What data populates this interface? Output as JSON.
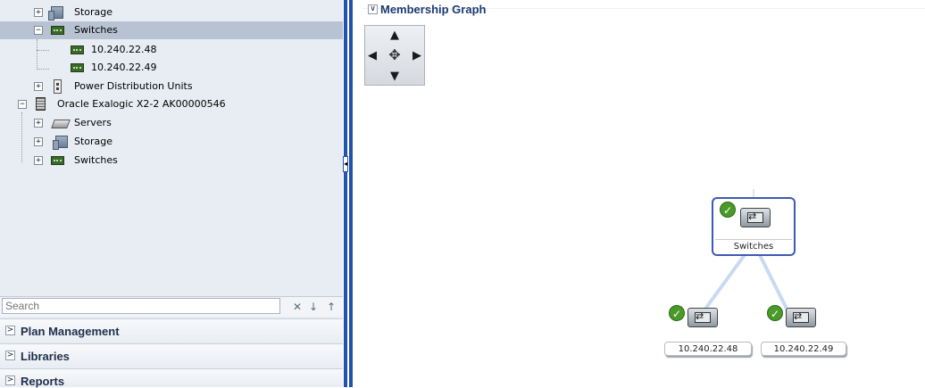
{
  "tree": {
    "items": [
      {
        "label": "Storage",
        "icon": "storage-icon",
        "expander": "+"
      },
      {
        "label": "Switches",
        "icon": "switch-icon",
        "expander": "−",
        "selected": true
      },
      {
        "label": "10.240.22.48",
        "icon": "switch-icon"
      },
      {
        "label": "10.240.22.49",
        "icon": "switch-icon"
      },
      {
        "label": "Power Distribution Units",
        "icon": "pdu-icon",
        "expander": "+"
      },
      {
        "label": "Oracle Exalogic X2-2 AK00000546",
        "icon": "rack-icon",
        "expander": "−"
      },
      {
        "label": "Servers",
        "icon": "server-icon",
        "expander": "+"
      },
      {
        "label": "Storage",
        "icon": "storage-icon",
        "expander": "+"
      },
      {
        "label": "Switches",
        "icon": "switch-icon",
        "expander": "+"
      }
    ]
  },
  "search": {
    "placeholder": "Search",
    "clear_glyph": "✕",
    "down_glyph": "↓",
    "up_glyph": "↑"
  },
  "accordions": [
    {
      "label": "Plan Management"
    },
    {
      "label": "Libraries"
    },
    {
      "label": "Reports"
    }
  ],
  "graph": {
    "title": "Membership Graph",
    "collapse_glyph": "∨",
    "pan": {
      "up": "▲",
      "down": "▼",
      "left": "◀",
      "right": "▶",
      "center": "✥"
    },
    "nodes": [
      {
        "label": "Switches",
        "status": "ok"
      },
      {
        "label": "10.240.22.48",
        "status": "ok"
      },
      {
        "label": "10.240.22.49",
        "status": "ok"
      }
    ],
    "check_glyph": "✓",
    "edge_color": "#c9daf0",
    "accent": "#3d5bb0"
  },
  "splitter": {
    "collapse_glyph": "◂"
  },
  "colors": {
    "pane_bg": "#e8edf3",
    "selected_row": "#b7c3d3",
    "splitter": "#2353a8",
    "header_text": "#1e2f4b"
  }
}
